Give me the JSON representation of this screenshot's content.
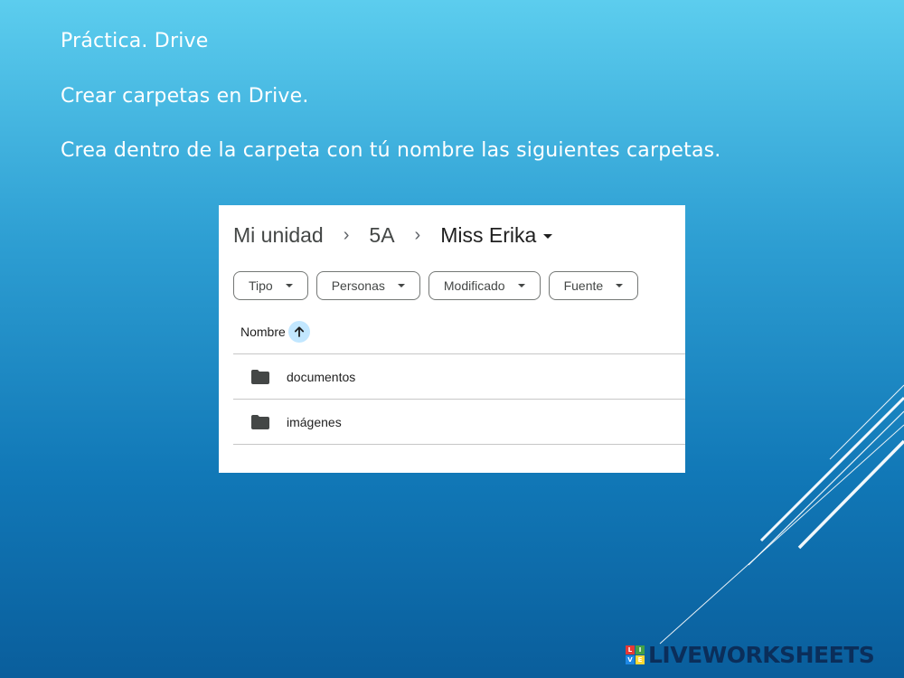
{
  "slide": {
    "title": "Práctica. Drive",
    "subtitle": "Crear carpetas en Drive.",
    "instruction": "Crea dentro de la carpeta con tú nombre las siguientes carpetas."
  },
  "drive": {
    "breadcrumb": [
      "Mi unidad",
      "5A",
      "Miss Erika"
    ],
    "filters": [
      "Tipo",
      "Personas",
      "Modificado",
      "Fuente"
    ],
    "column_header": "Nombre",
    "files": [
      {
        "name": "documentos",
        "icon": "folder-icon"
      },
      {
        "name": "imágenes",
        "icon": "folder-icon"
      }
    ]
  },
  "watermark": {
    "logo_letters": [
      "L",
      "I",
      "V",
      "E"
    ],
    "text": "LIVEWORKSHEETS"
  },
  "colors": {
    "sort_accent": "#c2e7ff",
    "folder": "#444746"
  }
}
